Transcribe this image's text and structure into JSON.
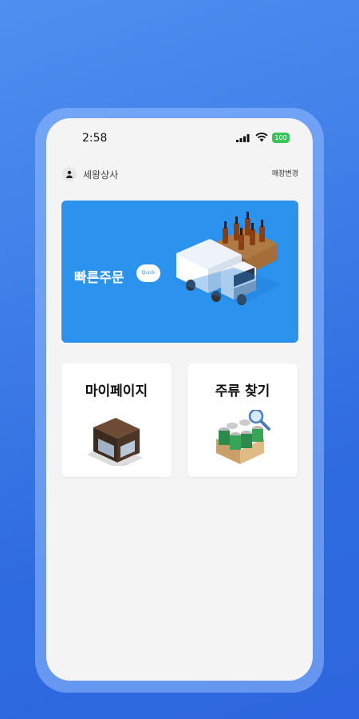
{
  "status_bar": {
    "time": "2:58",
    "battery": "100"
  },
  "header": {
    "store_name": "세왕상사",
    "change_store_label": "매장변경"
  },
  "banner": {
    "title": "빠른주문",
    "pill_label": "Quick"
  },
  "cards": [
    {
      "title": "마이페이지"
    },
    {
      "title": "주류 찾기"
    }
  ],
  "colors": {
    "background": "#3f7fe8",
    "banner": "#2b93ee",
    "battery": "#3cc45a"
  }
}
